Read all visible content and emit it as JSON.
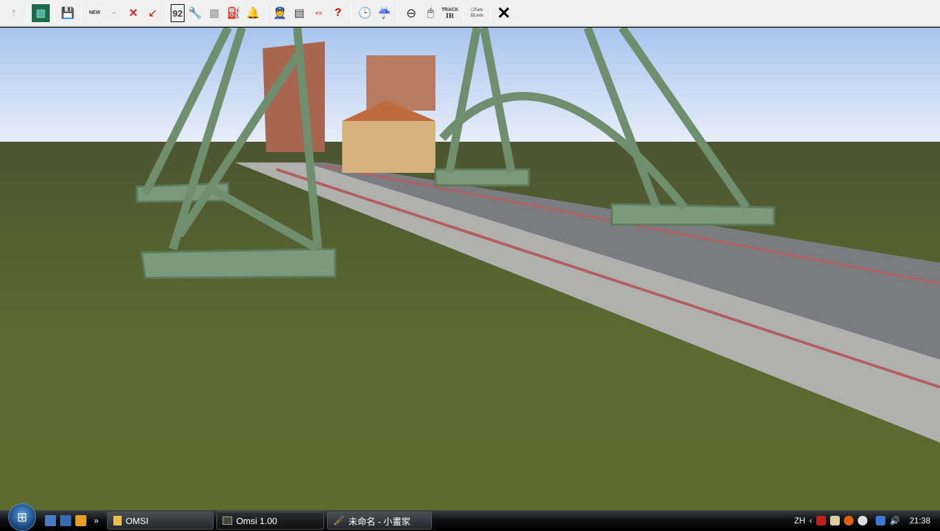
{
  "toolbar": {
    "items": [
      {
        "name": "up-arrow-icon",
        "glyph": "↑"
      },
      {
        "name": "map-icon",
        "glyph": "▦"
      },
      {
        "name": "save-icon",
        "glyph": "💾"
      },
      {
        "name": "new-bus-icon",
        "glyph": "🚌",
        "label": "NEW"
      },
      {
        "name": "swap-bus-icon",
        "glyph": "🚌",
        "label": "↔"
      },
      {
        "name": "remove-bus-icon",
        "glyph": "✕"
      },
      {
        "name": "pointer-icon",
        "glyph": "↙"
      },
      {
        "name": "route-number-icon",
        "glyph": "92"
      },
      {
        "name": "wrench-icon",
        "glyph": "🔧"
      },
      {
        "name": "ticket-icon",
        "glyph": "▩"
      },
      {
        "name": "fuel-icon",
        "glyph": "⛽"
      },
      {
        "name": "bell-icon",
        "glyph": "🔔"
      },
      {
        "name": "driver-icon",
        "glyph": "👮"
      },
      {
        "name": "timetable-icon",
        "glyph": "▤"
      },
      {
        "name": "ai-swap-icon",
        "glyph": "⇔"
      },
      {
        "name": "help-icon",
        "glyph": "?"
      },
      {
        "name": "clock-icon",
        "glyph": "🕒"
      },
      {
        "name": "weather-icon",
        "glyph": "☔"
      },
      {
        "name": "steering-wheel-icon",
        "glyph": "⊖"
      },
      {
        "name": "mouse-icon",
        "glyph": "🖱"
      },
      {
        "name": "trackir-icon",
        "label": "TRACK",
        "label2": "IR"
      },
      {
        "name": "mode-checkbox-icon",
        "label": "☐Fahr",
        "label2": "☒Lenk"
      },
      {
        "name": "close-icon",
        "glyph": "✕"
      }
    ]
  },
  "taskbar": {
    "tasks": [
      {
        "label": "OMSI"
      },
      {
        "label": "Omsi 1.00"
      },
      {
        "label": "未命名 - 小畫家"
      }
    ],
    "overflow": "»",
    "language": "ZH",
    "clock": "21:38"
  }
}
